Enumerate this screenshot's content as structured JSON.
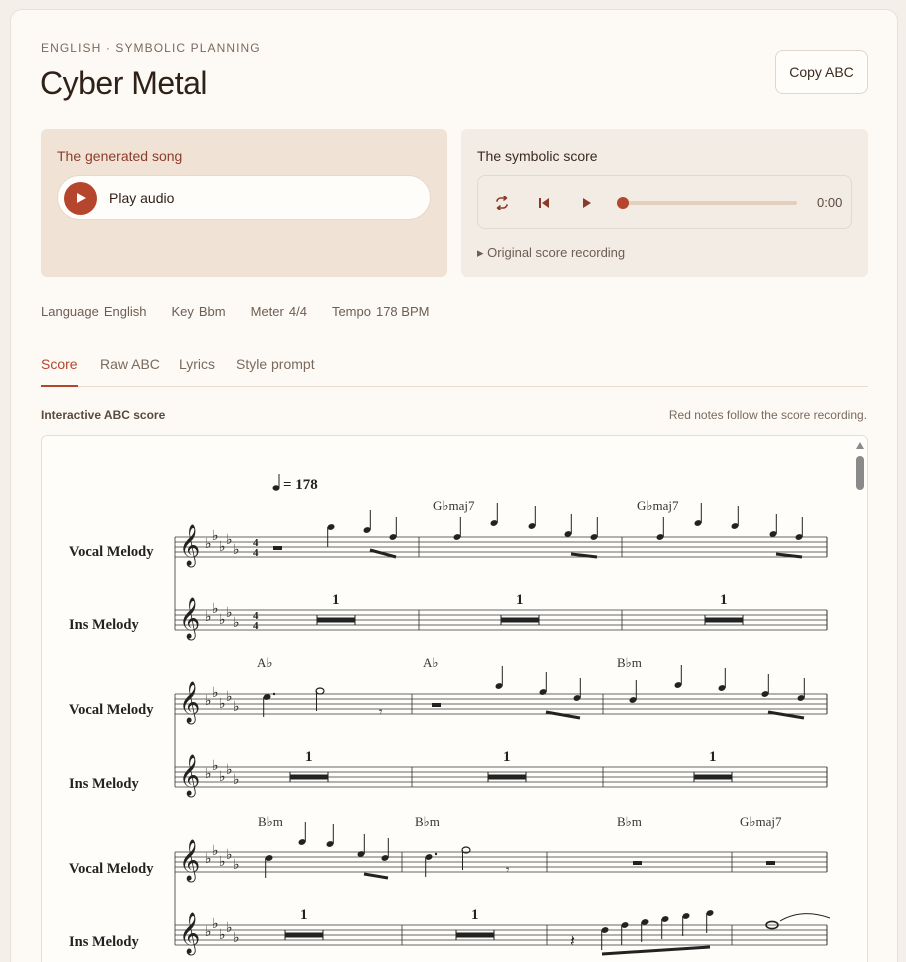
{
  "header": {
    "eyebrow": "ENGLISH · SYMBOLIC PLANNING",
    "title": "Cyber Metal",
    "copy_label": "Copy ABC"
  },
  "generated": {
    "heading": "The generated song",
    "play_label": "Play audio"
  },
  "symbolic": {
    "heading": "The symbolic score",
    "time": "0:00",
    "progress": 0,
    "details_label": "Original score recording"
  },
  "meta": [
    {
      "label": "Language",
      "value": "English"
    },
    {
      "label": "Key",
      "value": "Bbm"
    },
    {
      "label": "Meter",
      "value": "4/4"
    },
    {
      "label": "Tempo",
      "value": "178 BPM"
    }
  ],
  "tabs": [
    "Score",
    "Raw ABC",
    "Lyrics",
    "Style prompt"
  ],
  "active_tab": "Score",
  "score": {
    "label": "Interactive ABC score",
    "note": "Red notes follow the score recording.",
    "tempo": "= 178",
    "voices": [
      "Vocal Melody",
      "Ins Melody"
    ],
    "time_signature": [
      "4",
      "4"
    ],
    "rest_count": "1",
    "systems": [
      {
        "chords": [
          "G♭maj7",
          "G♭maj7"
        ]
      },
      {
        "chords": [
          "A♭",
          "A♭",
          "B♭m"
        ]
      },
      {
        "chords": [
          "B♭m",
          "B♭m",
          "B♭m",
          "G♭maj7"
        ]
      }
    ]
  },
  "colors": {
    "accent": "#b5452d",
    "panel_warm": "#f0e3d6",
    "panel_neutral": "#f3ece4"
  }
}
